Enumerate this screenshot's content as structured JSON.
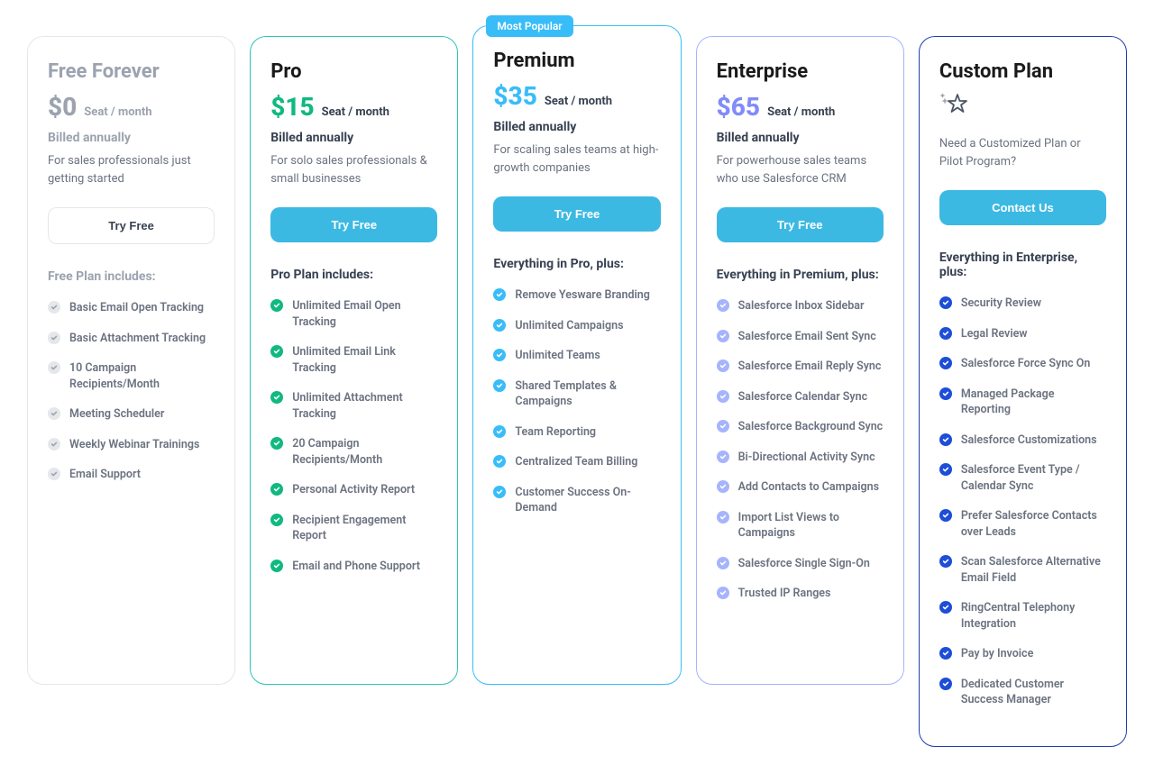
{
  "plans": {
    "free": {
      "name": "Free Forever",
      "price": "$0",
      "unit": "Seat / month",
      "billed": "Billed annually",
      "desc": "For sales professionals just getting started",
      "cta": "Try Free",
      "includes_heading": "Free Plan includes:",
      "features": [
        "Basic Email Open Tracking",
        "Basic Attachment Tracking",
        "10 Campaign Recipients/Month",
        "Meeting Scheduler",
        "Weekly Webinar Trainings",
        "Email Support"
      ]
    },
    "pro": {
      "name": "Pro",
      "price": "$15",
      "unit": "Seat / month",
      "billed": "Billed annually",
      "desc": "For solo sales professionals & small businesses",
      "cta": "Try Free",
      "includes_heading": "Pro Plan includes:",
      "features": [
        "Unlimited Email Open Tracking",
        "Unlimited Email Link Tracking",
        "Unlimited Attachment Tracking",
        "20 Campaign Recipients/Month",
        "Personal Activity Report",
        "Recipient Engagement Report",
        "Email and Phone Support"
      ]
    },
    "premium": {
      "badge": "Most Popular",
      "name": "Premium",
      "price": "$35",
      "unit": "Seat / month",
      "billed": "Billed annually",
      "desc": "For scaling sales teams at high-growth companies",
      "cta": "Try Free",
      "includes_heading": "Everything in Pro, plus:",
      "features": [
        "Remove Yesware Branding",
        "Unlimited Campaigns",
        "Unlimited Teams",
        "Shared Templates & Campaigns",
        "Team Reporting",
        "Centralized Team Billing",
        "Customer Success On-Demand"
      ]
    },
    "enterprise": {
      "name": "Enterprise",
      "price": "$65",
      "unit": "Seat / month",
      "billed": "Billed annually",
      "desc": "For powerhouse sales teams who use Salesforce CRM",
      "cta": "Try Free",
      "includes_heading": "Everything in Premium, plus:",
      "features": [
        "Salesforce Inbox Sidebar",
        "Salesforce Email Sent Sync",
        "Salesforce Email Reply Sync",
        "Salesforce Calendar Sync",
        "Salesforce Background Sync",
        "Bi-Directional Activity Sync",
        "Add Contacts to Campaigns",
        "Import List Views to Campaigns",
        "Salesforce Single Sign-On",
        "Trusted IP Ranges"
      ]
    },
    "custom": {
      "name": "Custom Plan",
      "desc": "Need a Customized Plan or Pilot Program?",
      "cta": "Contact Us",
      "includes_heading": "Everything in Enterprise, plus:",
      "features": [
        "Security Review",
        "Legal Review",
        "Salesforce Force Sync On",
        "Managed Package Reporting",
        "Salesforce Customizations",
        "Salesforce Event Type / Calendar Sync",
        "Prefer Salesforce Contacts over Leads",
        "Scan Salesforce Alternative Email Field",
        "RingCentral Telephony Integration",
        "Pay by Invoice",
        "Dedicated Customer Success Manager"
      ]
    }
  }
}
